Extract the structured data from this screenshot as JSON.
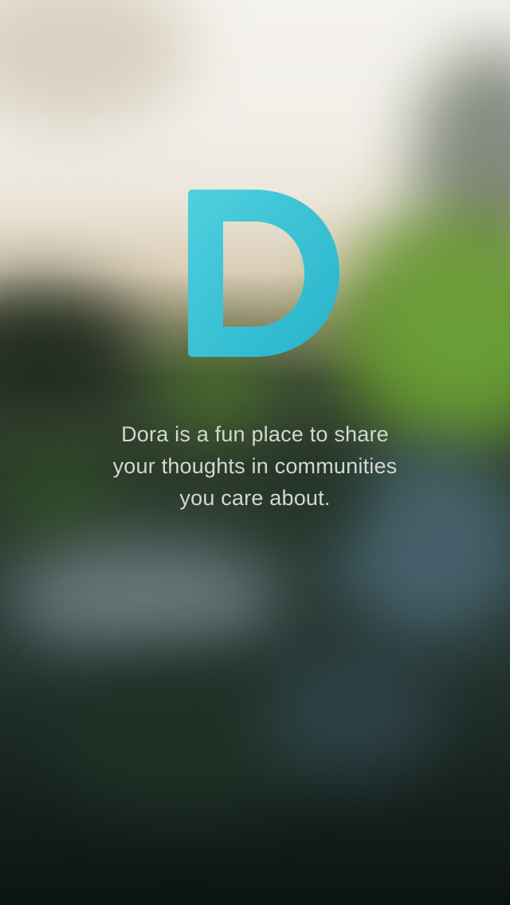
{
  "app": {
    "logo_letter": "D",
    "logo_icon": "dora-logo-icon",
    "logo_colors": [
      "#4fd0de",
      "#27b3cb"
    ]
  },
  "tagline": {
    "lines": [
      "Dora is a fun place to share",
      "your thoughts in communities",
      "you care about."
    ]
  }
}
